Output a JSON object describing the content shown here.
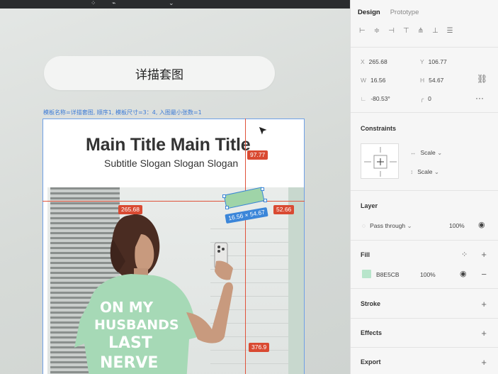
{
  "canvas": {
    "pill_title": "详描套图",
    "frame_label": "模板名称=详描套图, 顺序1, 模板尺寸=3：4, 入图最小张数=1",
    "main_title": "Main Title Main Title",
    "subtitle": "Subtitle Slogan Slogan Slogan",
    "measure_top": "97.77",
    "measure_left": "265.68",
    "measure_right": "52.66",
    "measure_bottom": "376.9",
    "selection_size": "16.56 × 54.67",
    "shirt_text": [
      "ON MY",
      "HUSBANDS",
      "LAST",
      "NERVE"
    ]
  },
  "panel": {
    "tabs": [
      {
        "label": "Design",
        "active": true
      },
      {
        "label": "Prototype",
        "active": false
      }
    ],
    "position": {
      "x_label": "X",
      "x_value": "265.68",
      "y_label": "Y",
      "y_value": "106.77",
      "w_label": "W",
      "w_value": "16.56",
      "h_label": "H",
      "h_value": "54.67",
      "rotation_value": "-80.53°",
      "radius_value": "0"
    },
    "constraints": {
      "title": "Constraints",
      "horizontal": "Scale",
      "vertical": "Scale"
    },
    "layer": {
      "title": "Layer",
      "blend_mode": "Pass through",
      "opacity": "100%"
    },
    "fill": {
      "title": "Fill",
      "hex": "B8E5CB",
      "color": "#b8e5cb",
      "opacity": "100%"
    },
    "stroke": {
      "title": "Stroke"
    },
    "effects": {
      "title": "Effects"
    },
    "export": {
      "title": "Export"
    }
  }
}
